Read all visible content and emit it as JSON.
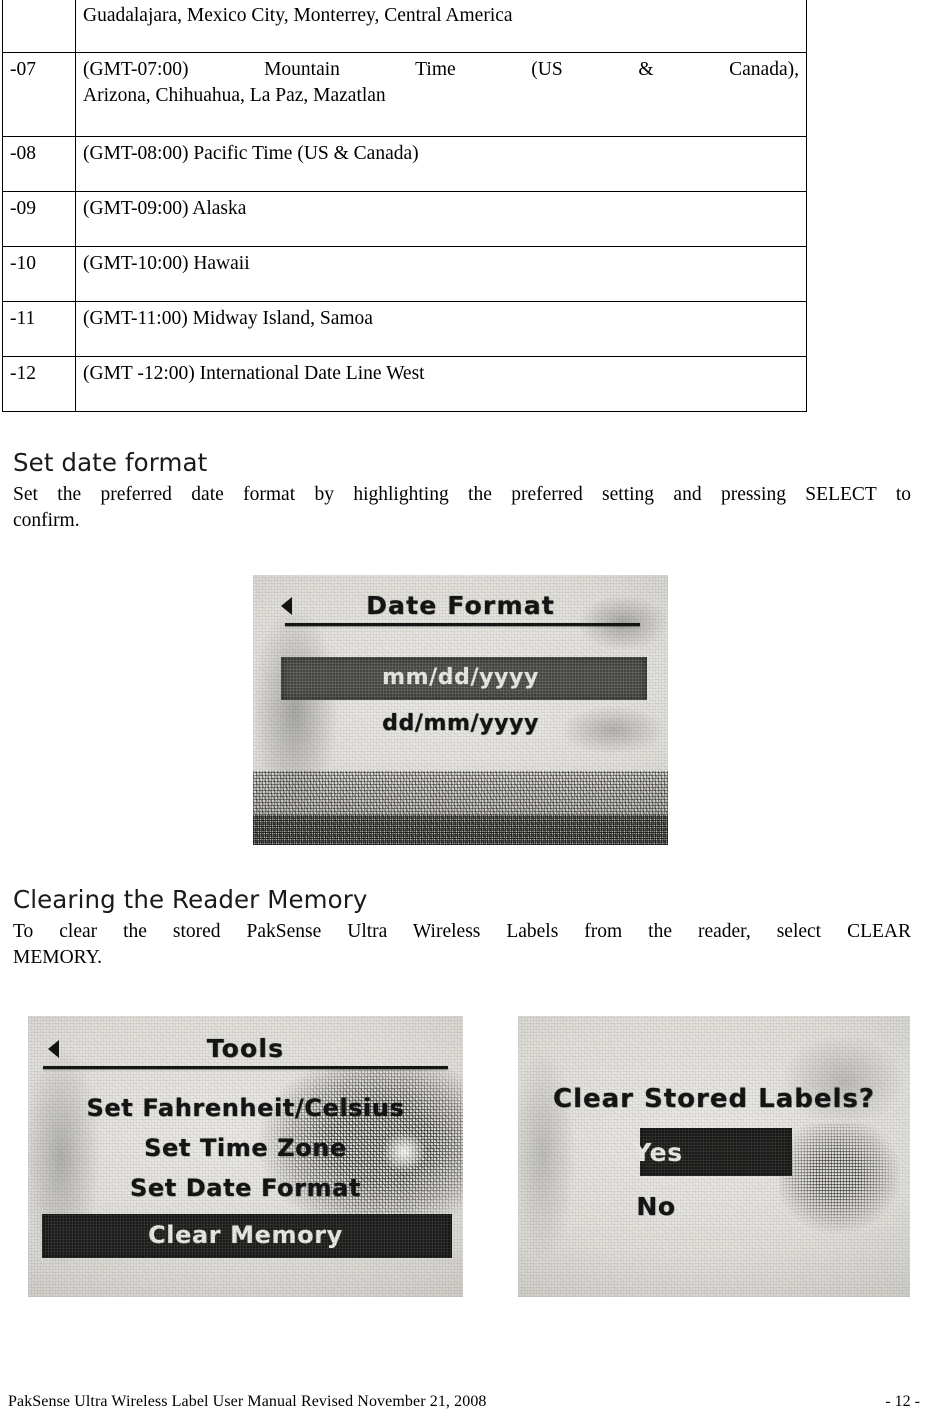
{
  "document": {
    "footer_left": "PakSense Ultra Wireless Label User Manual Revised November 21, 2008",
    "footer_right": "- 12 -"
  },
  "timezone_table": {
    "rows": [
      {
        "code": "",
        "description": "Guadalajara, Mexico City, Monterrey, Central America",
        "continued": true
      },
      {
        "code": "-07",
        "line1": "(GMT-07:00) Mountain Time (US & Canada),",
        "line2": "Arizona, Chihuahua, La Paz, Mazatlan"
      },
      {
        "code": "-08",
        "description": "(GMT-08:00) Pacific Time (US & Canada)"
      },
      {
        "code": "-09",
        "description": "(GMT-09:00) Alaska"
      },
      {
        "code": "-10",
        "description": "(GMT-10:00) Hawaii"
      },
      {
        "code": "-11",
        "description": "(GMT-11:00) Midway Island, Samoa"
      },
      {
        "code": "-12",
        "description": "(GMT -12:00) International Date Line West"
      }
    ]
  },
  "sections": [
    {
      "heading": "Set date format",
      "paragraph_line1": "Set the preferred date format by highlighting the preferred setting and pressing SELECT to",
      "paragraph_line2": "confirm."
    },
    {
      "heading": "Clearing the Reader Memory",
      "paragraph_line1": "To clear the stored PakSense Ultra Wireless Labels from the reader, select CLEAR",
      "paragraph_line2": "MEMORY."
    }
  ],
  "figures": {
    "date_format_screen": {
      "back_icon": "back-arrow-icon",
      "title": "Date Format",
      "options": [
        {
          "label": "mm/dd/yyyy",
          "selected": true
        },
        {
          "label": "dd/mm/yyyy",
          "selected": false
        }
      ]
    },
    "tools_screen": {
      "back_icon": "back-arrow-icon",
      "title": "Tools",
      "options": [
        {
          "label": "Set Fahrenheit/Celsius",
          "selected": false
        },
        {
          "label": "Set Time Zone",
          "selected": false
        },
        {
          "label": "Set Date Format",
          "selected": false
        },
        {
          "label": "Clear Memory",
          "selected": true
        }
      ]
    },
    "clear_confirm_screen": {
      "title": "Clear Stored Labels?",
      "options": [
        {
          "label": "Yes",
          "selected": true
        },
        {
          "label": "No",
          "selected": false
        }
      ]
    }
  },
  "colors": {
    "text": "#000000",
    "lcd_background": "#e4e2dd",
    "lcd_highlight": "#3c3c3a",
    "lcd_highlight_text": "#eceae4"
  }
}
